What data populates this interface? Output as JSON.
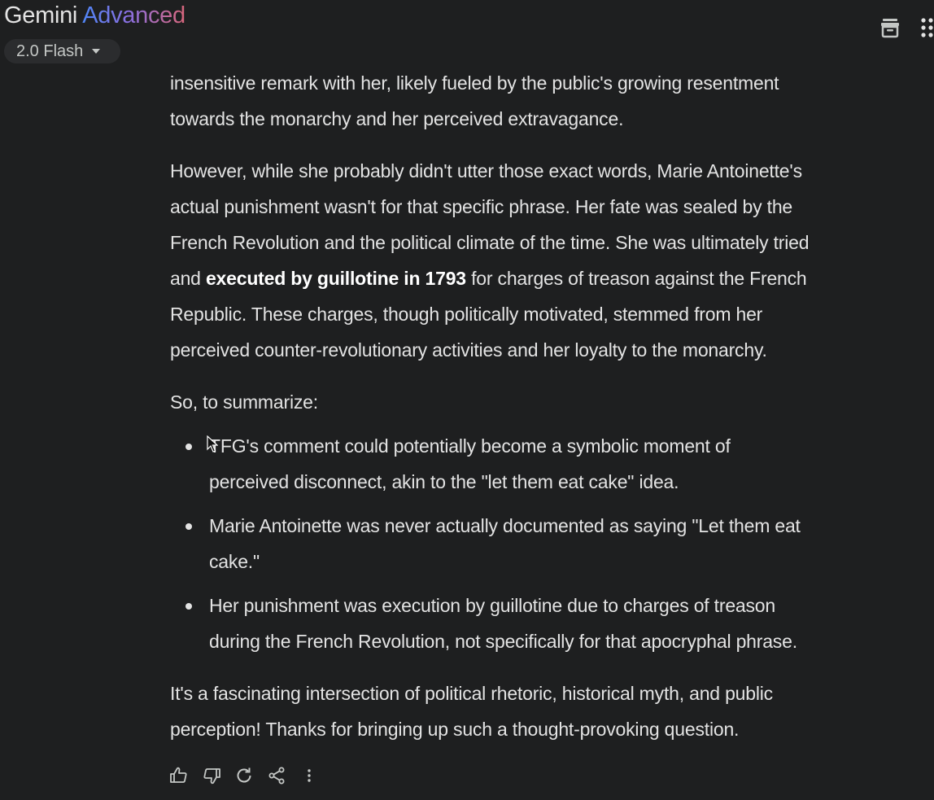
{
  "header": {
    "brand_name": "Gemini",
    "brand_tier": "Advanced",
    "model": "2.0 Flash"
  },
  "response": {
    "p1_line1": "insensitive remark with her, likely fueled by the public's growing resentment",
    "p1_line2": "towards the monarchy and her perceived extravagance.",
    "p2_line1": "However, while she probably didn't utter those exact words, Marie Antoinette's",
    "p2_line2": "actual punishment wasn't for that specific phrase. Her fate was sealed by the",
    "p2_line3": "French Revolution and the political climate of the time. She was ultimately tried",
    "p2_line4_pre": "and ",
    "p2_line4_bold": "executed by guillotine in 1793",
    "p2_line4_post": " for charges of treason against the French",
    "p2_line5": "Republic. These charges, though politically motivated, stemmed from her",
    "p2_line6": "perceived counter-revolutionary activities and her loyalty to the monarchy.",
    "summary_intro": "So, to summarize:",
    "bullets": [
      {
        "line1": "TFG's comment could potentially become a symbolic moment of",
        "line2": "perceived disconnect, akin to the \"let them eat cake\" idea."
      },
      {
        "line1": "Marie Antoinette was never actually documented as saying \"Let them eat",
        "line2": "cake.\""
      },
      {
        "line1": "Her punishment was execution by guillotine due to charges of treason",
        "line2": "during the French Revolution, not specifically for that apocryphal phrase."
      }
    ],
    "closing_line1": "It's a fascinating intersection of political rhetoric, historical myth, and public",
    "closing_line2": "perception! Thanks for bringing up such a thought-provoking question."
  },
  "actions": {
    "icons": [
      "thumb-up-icon",
      "thumb-down-icon",
      "regenerate-icon",
      "share-icon",
      "more-vert-icon"
    ]
  },
  "colors": {
    "background": "#1e1f20",
    "text": "#e3e3e3",
    "pill": "#2b2c2e"
  }
}
